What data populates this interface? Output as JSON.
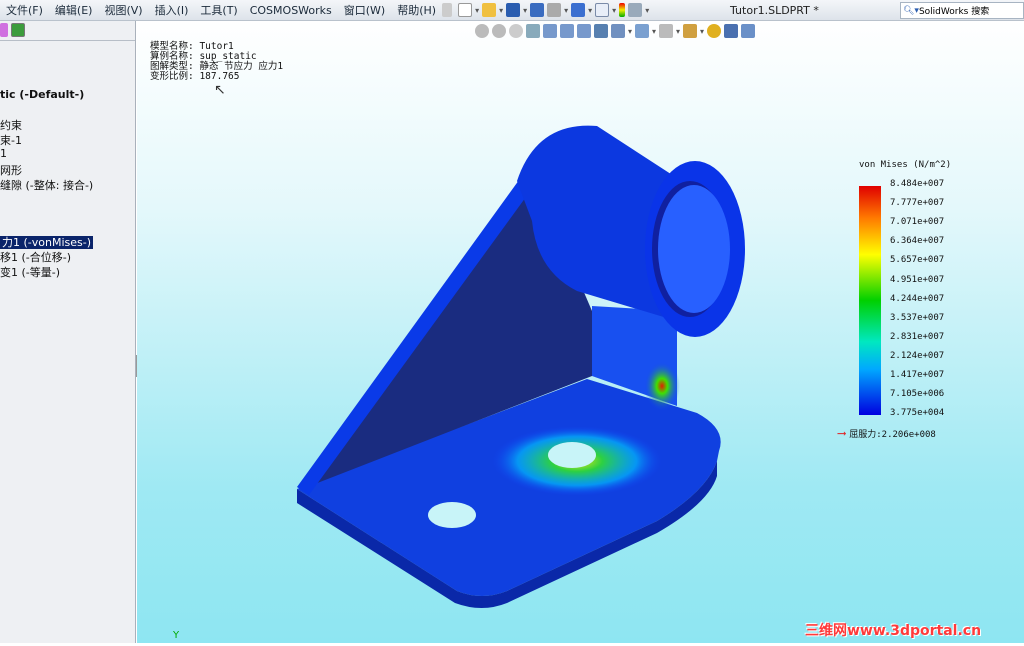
{
  "menubar": {
    "items": [
      "文件(F)",
      "编辑(E)",
      "视图(V)",
      "插入(I)",
      "工具(T)",
      "COSMOSWorks",
      "窗口(W)",
      "帮助(H)"
    ]
  },
  "window": {
    "title": "Tutor1.SLDPRT *"
  },
  "search": {
    "placeholder": "SolidWorks 搜索"
  },
  "tree": {
    "items": [
      "tic (-Default-)",
      "约束",
      "束-1",
      "1",
      "网形",
      "缝隙 (-整体: 接合-)",
      "力1 (-vonMises-)",
      "移1 (-合位移-)",
      "变1 (-等量-)"
    ],
    "selected_index": 6
  },
  "info": {
    "lines": [
      "模型名称: Tutor1",
      "算例名称: sup_static",
      "图解类型: 静态 节应力 应力1",
      "变形比例: 187.765"
    ]
  },
  "legend": {
    "title": "von Mises (N/m^2)",
    "ticks": [
      "8.484e+007",
      "7.777e+007",
      "7.071e+007",
      "6.364e+007",
      "5.657e+007",
      "4.951e+007",
      "4.244e+007",
      "3.537e+007",
      "2.831e+007",
      "2.124e+007",
      "1.417e+007",
      "7.105e+006",
      "3.775e+004"
    ],
    "yield": "屈服力:2.206e+008",
    "yield_color": "#e02020"
  },
  "axis": {
    "label": "Y"
  },
  "watermark": "三维网www.3dportal.cn"
}
